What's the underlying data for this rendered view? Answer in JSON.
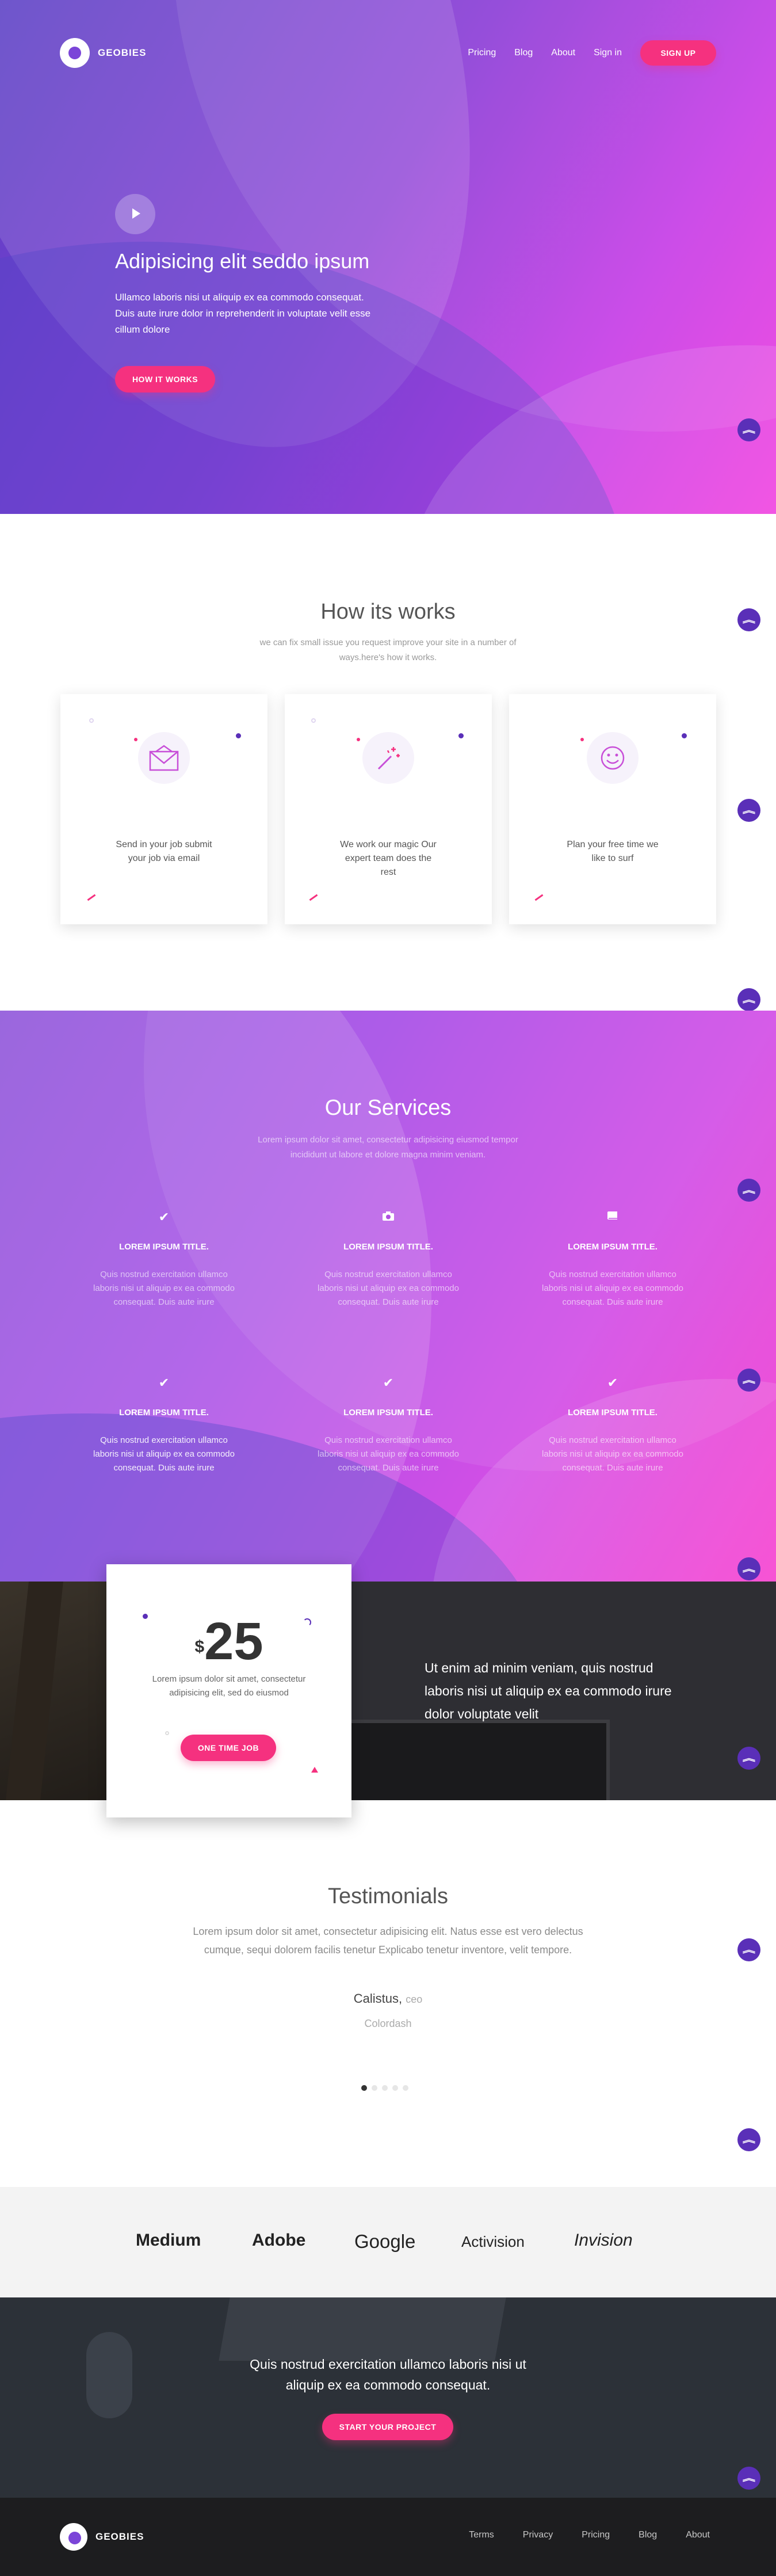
{
  "brand": {
    "name": "GEOBIES"
  },
  "nav": {
    "items": [
      "Pricing",
      "Blog",
      "About",
      "Sign in"
    ],
    "signup_label": "SIGN UP"
  },
  "hero": {
    "title": "Adipisicing elit seddo ipsum",
    "text": "Ullamco laboris nisi ut aliquip ex ea commodo consequat. Duis aute irure dolor in reprehenderit in voluptate velit esse cillum dolore",
    "button_label": "HOW IT WORKS"
  },
  "how": {
    "title": "How its works",
    "subtitle": "we can fix small issue you request improve your site in a number of ways.here's how it works.",
    "cards": [
      {
        "icon": "envelope-icon",
        "text": "Send in your job submit your job via email"
      },
      {
        "icon": "magic-wand-icon",
        "text": "We work our magic Our expert team does the rest"
      },
      {
        "icon": "smiley-icon",
        "text": "Plan your free time we like to surf"
      }
    ]
  },
  "services": {
    "title": "Our Services",
    "subtitle": "Lorem ipsum dolor sit amet, consectetur adipisicing eiusmod tempor incididunt ut labore et dolore magna minim veniam.",
    "items": [
      {
        "icon": "check-icon",
        "title": "LOREM IPSUM TITLE.",
        "text": "Quis nostrud exercitation ullamco laboris nisi ut aliquip ex ea commodo consequat. Duis aute irure"
      },
      {
        "icon": "camera-icon",
        "title": "LOREM IPSUM TITLE.",
        "text": "Quis nostrud exercitation ullamco laboris nisi ut aliquip ex ea commodo consequat. Duis aute irure"
      },
      {
        "icon": "book-icon",
        "title": "LOREM IPSUM TITLE.",
        "text": "Quis nostrud exercitation ullamco laboris nisi ut aliquip ex ea commodo consequat. Duis aute irure"
      },
      {
        "icon": "check-icon",
        "title": "LOREM IPSUM TITLE.",
        "text": "Quis nostrud exercitation ullamco laboris nisi ut aliquip ex ea commodo consequat. Duis aute irure"
      },
      {
        "icon": "check-icon",
        "title": "LOREM IPSUM TITLE.",
        "text": "Quis nostrud exercitation ullamco laboris nisi ut aliquip ex ea commodo consequat. Duis aute irure"
      },
      {
        "icon": "check-icon",
        "title": "LOREM IPSUM TITLE.",
        "text": "Quis nostrud exercitation ullamco laboris nisi ut aliquip ex ea commodo consequat. Duis aute irure"
      }
    ]
  },
  "pricing": {
    "currency": "$",
    "amount": "25",
    "text": "Lorem ipsum dolor sit amet, consectetur adipisicing elit, sed do eiusmod",
    "button_label": "ONE TIME JOB",
    "side_text": "Ut enim ad minim veniam, quis nostrud laboris nisi ut aliquip ex ea commodo irure dolor voluptate velit"
  },
  "testimonials": {
    "title": "Testimonials",
    "quote": "Lorem ipsum dolor sit amet, consectetur adipisicing elit. Natus esse est vero delectus cumque, sequi dolorem facilis tenetur Explicabo tenetur inventore, velit tempore.",
    "author": "Calistus,",
    "role": "ceo",
    "company": "Colordash",
    "active_dot": 1,
    "dot_count": 5
  },
  "logos": [
    "Medium",
    "Adobe",
    "Google",
    "Activision",
    "Invision"
  ],
  "cta": {
    "text": "Quis nostrud exercitation ullamco laboris nisi ut aliquip ex ea commodo consequat.",
    "button_label": "START YOUR PROJECT"
  },
  "footer": {
    "links": [
      "Terms",
      "Privacy",
      "Pricing",
      "Blog",
      "About"
    ]
  },
  "colors": {
    "accent": "#f5317f",
    "purple": "#5a2fb8"
  }
}
